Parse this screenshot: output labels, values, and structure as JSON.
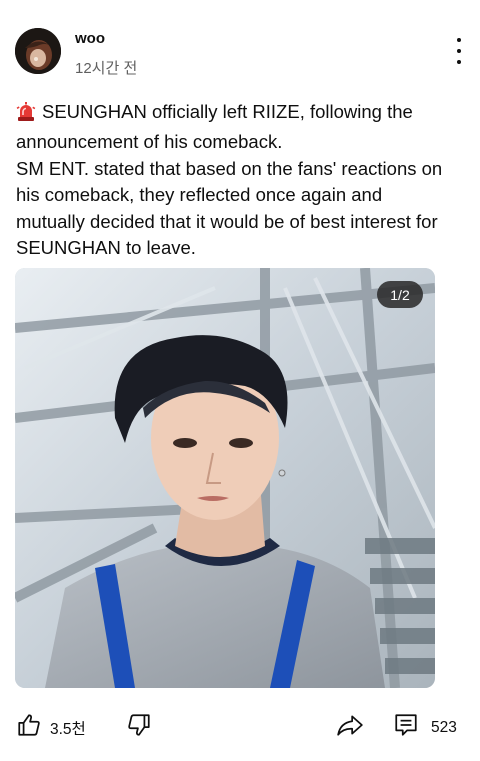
{
  "post": {
    "author": "woo",
    "time": "12시간 전",
    "paragraph1": "SEUNGHAN officially left RIIZE, following the announcement of his comeback.",
    "paragraph2": "SM ENT. stated that based on the fans' reactions on his comeback, they reflected once again and mutually decided that it would be of best interest for SEUNGHAN to leave.",
    "image_counter": "1/2"
  },
  "actions": {
    "like_count": "3.5천",
    "comment_count": "523"
  },
  "icons": [
    "siren-icon",
    "more-vert-icon",
    "thumb-up-icon",
    "thumb-down-icon",
    "share-icon",
    "comment-icon"
  ],
  "colors": {
    "text": "#0f0f0f",
    "secondary_text": "#606060",
    "siren_red": "#e53935"
  }
}
